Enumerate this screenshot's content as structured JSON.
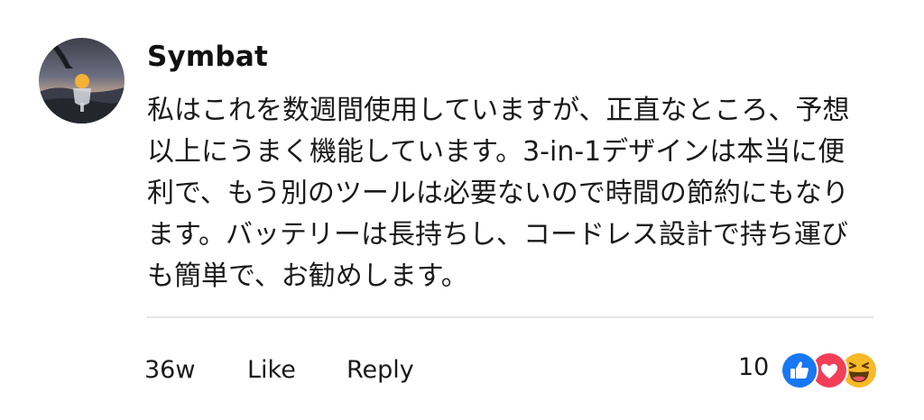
{
  "comment": {
    "author": "Symbat",
    "text": "私はこれを数週間使用していますが、正直なところ、予想以上にうまく機能しています。3-in-1デザインは本当に便利で、もう別のツールは必要ないので時間の節約にもなります。バッテリーは長持ちし、コードレス設計で持ち運びも簡単で、お勧めします。",
    "timestamp": "36w",
    "like_label": "Like",
    "reply_label": "Reply",
    "reaction_count": "10",
    "reactions": [
      "like-icon",
      "love-icon",
      "haha-icon"
    ]
  },
  "colors": {
    "like": "#1877f2",
    "love": "#f33e58",
    "haha": "#f7b928",
    "divider": "#e4e6eb"
  }
}
